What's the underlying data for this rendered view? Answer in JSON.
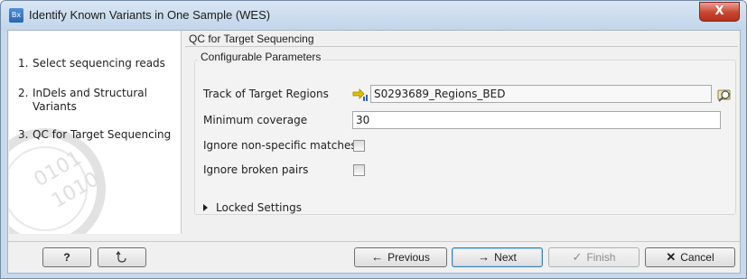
{
  "window": {
    "title": "Identify Known Variants in One Sample (WES)",
    "app_icon_text": "Bx",
    "close_glyph": "X"
  },
  "steps": [
    {
      "num": "1.",
      "label": "Select sequencing reads"
    },
    {
      "num": "2.",
      "label": "InDels and Structural Variants"
    },
    {
      "num": "3.",
      "label": "QC for Target Sequencing"
    }
  ],
  "content": {
    "section_title": "QC for Target Sequencing",
    "group_title": "Configurable Parameters",
    "track_label": "Track of Target Regions",
    "track_value": "S0293689_Regions_BED",
    "min_coverage_label": "Minimum coverage",
    "min_coverage_value": "30",
    "ignore_nonspecific_label": "Ignore non-specific matches",
    "ignore_nonspecific_checked": false,
    "ignore_broken_label": "Ignore broken pairs",
    "ignore_broken_checked": false,
    "locked_label": "Locked Settings"
  },
  "buttons": {
    "help": "?",
    "previous": "Previous",
    "next": "Next",
    "finish": "Finish",
    "cancel": "Cancel"
  },
  "colors": {
    "window_frame": "#c9d9ec",
    "close_button": "#c9452f",
    "primary_button_border": "#3c7fb1",
    "track_icon": "#e0c000"
  }
}
